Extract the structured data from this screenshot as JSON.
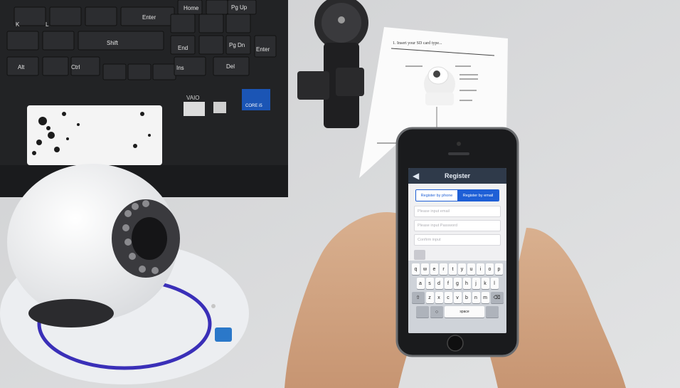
{
  "phone_app": {
    "title": "Register",
    "back_icon": "back-arrow-icon",
    "tabs": [
      {
        "label": "Register by phone",
        "active": false
      },
      {
        "label": "Register by email",
        "active": true
      }
    ],
    "fields": [
      {
        "placeholder": "Please input email"
      },
      {
        "placeholder": "Please input Password"
      },
      {
        "placeholder": "Confirm input"
      }
    ],
    "keyboard": {
      "row1": [
        "q",
        "w",
        "e",
        "r",
        "t",
        "y",
        "u",
        "i",
        "o",
        "p"
      ],
      "row2": [
        "a",
        "s",
        "d",
        "f",
        "g",
        "h",
        "j",
        "k",
        "l"
      ],
      "row3": [
        "z",
        "x",
        "c",
        "v",
        "b",
        "n",
        "m"
      ],
      "space_label": "space"
    }
  },
  "laptop": {
    "brand": "VAIO",
    "keys": [
      "Home",
      "Pg Up",
      "Enter",
      "Shift",
      "Ctrl",
      "Alt",
      "End",
      "Pg Dn",
      "Ins",
      "Del",
      "K",
      "L"
    ],
    "sticker": "CORE i5"
  },
  "manual": {
    "heading": "1. Insert your SD card type..."
  },
  "colors": {
    "accent_blue": "#1e5fd6",
    "camera_ring": "#3a2fb8",
    "app_bar": "#2f3a4a"
  }
}
